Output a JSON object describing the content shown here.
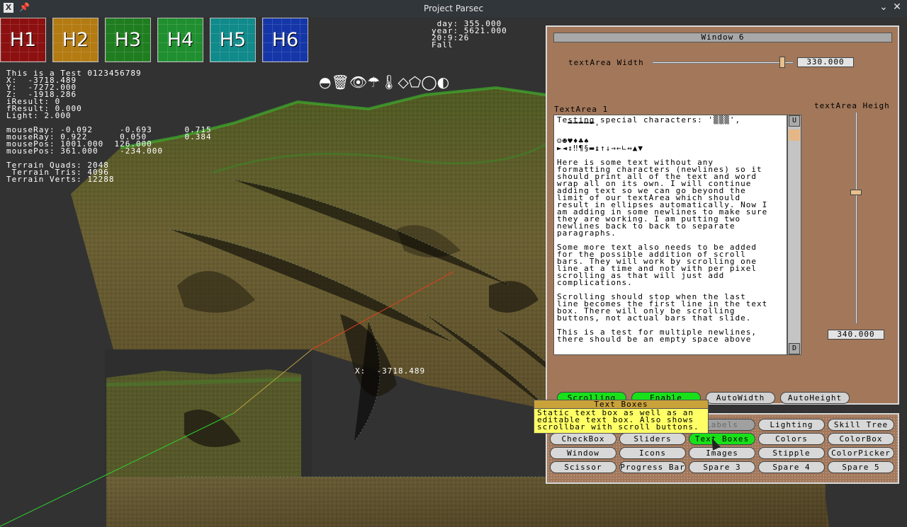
{
  "window": {
    "title": "Project Parsec",
    "app_icon": "x11-icon",
    "pin_icon": "pin-icon",
    "minimize_glyph": "⌄",
    "close_glyph": "✕"
  },
  "header_buttons": [
    {
      "label": "H1",
      "color": "#8c1010"
    },
    {
      "label": "H2",
      "color": "#b37b12"
    },
    {
      "label": "H3",
      "color": "#1f7d1f"
    },
    {
      "label": "H4",
      "color": "#1f8f2f"
    },
    {
      "label": "H5",
      "color": "#108a8a"
    },
    {
      "label": "H6",
      "color": "#1436a8"
    }
  ],
  "debug": {
    "lines_a": "This is a Test 0123456789\nX:  -3718.489\nY:  -7272.000\nZ:  -1918.286\niResult: 0\nfResult: 0.000\nLight: 2.000",
    "lines_b": "mouseRay: -0.092     -0.693      0.715\nmouseRay: 0.922      0.050       0.384\nmousePos: 1001.000  126.000\nmousePos: 361.000    -234.000",
    "lines_c": "Terrain Quads: 2048\n Terrain Tris: 4096\nTerrain Verts: 12288"
  },
  "time": {
    "text": " day: 355.000\nyear: 5621.000\n20:9:26\nFall"
  },
  "toolbar_icons": "◓🗑👁☂🌡◇⬠◯◐",
  "world_label": "X:  -3718.489",
  "panel": {
    "title": "Window 6",
    "width_label": "textArea Width",
    "width_value": "330.000",
    "width_fraction": 0.92,
    "height_label": "textArea Heigh",
    "height_value": "340.000",
    "height_fraction": 0.62,
    "textarea_label": "TextArea 1",
    "textarea_paragraphs": [
      "Testing special characters: '▒▒▒',\n  ▔▔▔▔▔'\n\n☺☻♥♦♣♠\n►◄↕‼¶§▬↨↑↓→←∟↔▲▼",
      "Here is some text without any\nformatting characters (newlines) so it\nshould print all of the text and word\nwrap all on its own. I will continue\nadding text so we can go beyond the\nlimit of our textArea which should\nresult in ellipses automatically. Now I\nam adding in some newlines to make sure\nthey are working. I am putting two\nnewlines back to back to separate\nparagraphs.",
      "Some more text also needs to be added\nfor the possible addition of scroll\nbars. They will work by scrolling one\nline at a time and not with per pixel\nscrolling as that will just add\ncomplications.",
      "Scrolling should stop when the last\nline becomes the first line in the text\nbox. There will only be scrolling\nbuttons, not actual bars that slide.",
      "This is a test for multiple newlines,\nthere should be an empty space above"
    ],
    "scroll_up": "U",
    "scroll_down": "D",
    "toggles": [
      {
        "label": "Scrolling",
        "on": true
      },
      {
        "label": "Enable",
        "on": true
      },
      {
        "label": "AutoWidth",
        "on": false
      },
      {
        "label": "AutoHeight",
        "on": false
      }
    ]
  },
  "menu": {
    "row1": [
      "Labels",
      "Lighting",
      "Skill Tree"
    ],
    "row2": [
      "CheckBox",
      "Sliders",
      "Text Boxes",
      "Colors",
      "ColorBox"
    ],
    "row3": [
      "Window",
      "Icons",
      "Images",
      "Stipple",
      "ColorPicker"
    ],
    "row4": [
      "Scissor",
      "Progress Bar",
      "Spare 3",
      "Spare 4",
      "Spare 5"
    ]
  },
  "tooltip": {
    "title": "Text Boxes",
    "body": "Static text box as well as an\neditable text box. Also shows\nscrollbar with scroll buttons."
  },
  "colors": {
    "panel_bg": "#a2775a",
    "toggle_on": "#18e11a",
    "tooltip_bg": "#ffff66"
  }
}
